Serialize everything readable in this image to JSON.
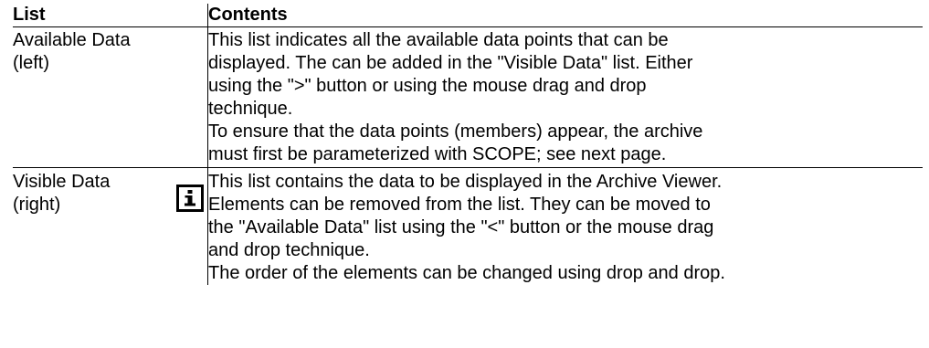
{
  "table": {
    "headers": {
      "list": "List",
      "contents": "Contents"
    },
    "rows": [
      {
        "list_lines": [
          "Available Data",
          "(left)"
        ],
        "content_lines": [
          "This list indicates all the available data points that can be",
          "displayed. The can be added in the \"Visible Data\" list. Either",
          "using the \">\" button or using the mouse drag and drop",
          "technique.",
          "To ensure that the data points (members) appear, the archive",
          "must first be parameterized with SCOPE; see next page."
        ],
        "icon": "info-icon"
      },
      {
        "list_lines": [
          "Visible Data",
          "(right)"
        ],
        "content_lines": [
          "This list contains the data to be displayed in the Archive Viewer.",
          "Elements can be removed from the list. They can be moved to",
          "the \"Available Data\" list using the \"<\" button or the mouse drag",
          "and drop technique.",
          "The order of the elements can be changed using drop and drop."
        ]
      }
    ]
  }
}
